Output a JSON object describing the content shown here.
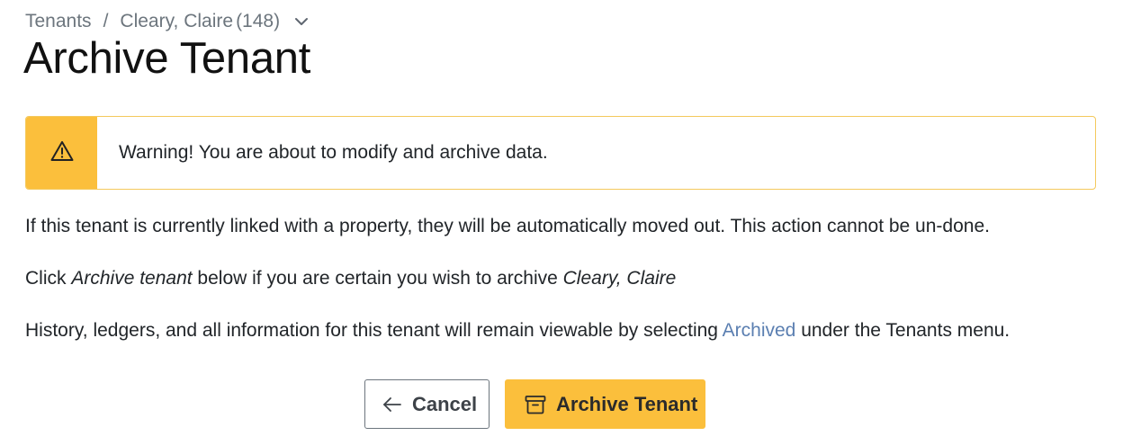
{
  "breadcrumb": {
    "root": "Tenants",
    "separator": "/",
    "tenant_name": "Cleary, Claire",
    "tenant_count": "(148)",
    "dropdown_icon": "chevron-down-icon"
  },
  "page": {
    "title": "Archive Tenant"
  },
  "alert": {
    "icon": "warning-triangle-icon",
    "message": "Warning! You are about to modify and archive data.",
    "accent_color": "#fbbf3c"
  },
  "body": {
    "paragraph1": "If this tenant is currently linked with a property, they will be automatically moved out. This action cannot be un-done.",
    "paragraph2_prefix": "Click ",
    "paragraph2_action": "Archive tenant",
    "paragraph2_middle": " below if you are certain you wish to archive ",
    "paragraph2_name": "Cleary, Claire",
    "paragraph3_prefix": "History, ledgers, and all information for this tenant will remain viewable by selecting ",
    "paragraph3_link": "Archived",
    "paragraph3_suffix": " under the Tenants menu."
  },
  "actions": {
    "cancel_label": "Cancel",
    "cancel_icon": "arrow-left-icon",
    "archive_label": "Archive Tenant",
    "archive_icon": "archive-box-icon"
  }
}
